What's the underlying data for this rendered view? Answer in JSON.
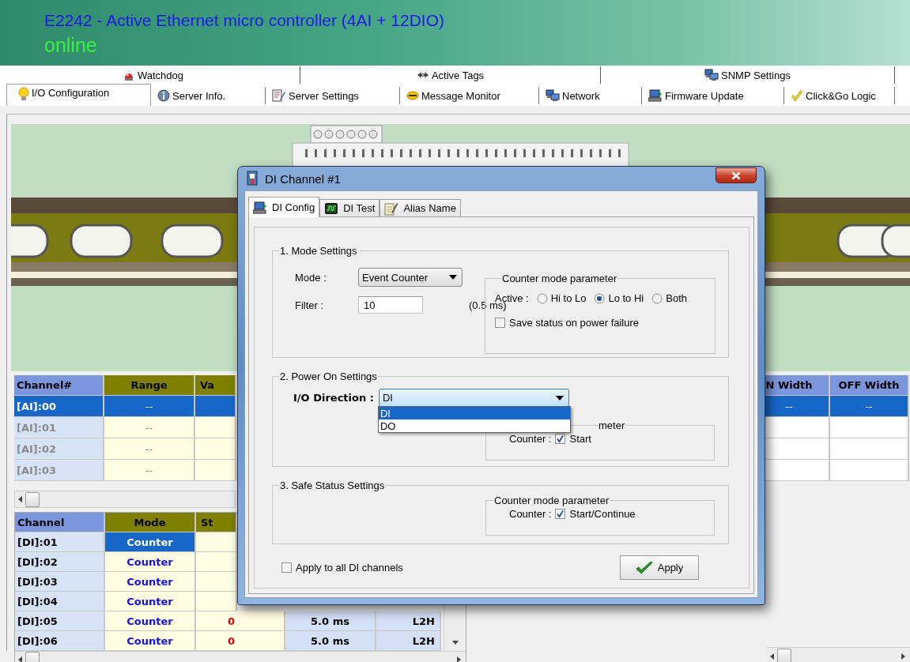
{
  "app": {
    "title": "E2242 - Active Ethernet micro controller (4AI + 12DIO)",
    "status": "online"
  },
  "tabs_top": [
    {
      "label": "Watchdog",
      "selected": false
    },
    {
      "label": "Active Tags",
      "selected": false
    },
    {
      "label": "SNMP Settings",
      "selected": false
    }
  ],
  "tabs_main": [
    {
      "label": "I/O Configuration",
      "selected": true
    },
    {
      "label": "Server Info.",
      "selected": false
    },
    {
      "label": "Server Settings",
      "selected": false
    },
    {
      "label": "Message Monitor",
      "selected": false
    },
    {
      "label": "Network",
      "selected": false
    },
    {
      "label": "Firmware Update",
      "selected": false
    },
    {
      "label": "Click&Go Logic",
      "selected": false
    }
  ],
  "ai_table": {
    "columns": [
      "Channel#",
      "Range",
      "Va",
      "N Width",
      "OFF Width"
    ],
    "rows": [
      {
        "channel": "[AI]:00",
        "range": "--",
        "n_width": "--",
        "off_width": "--",
        "selected": true,
        "disabled": false
      },
      {
        "channel": "[AI]:01",
        "range": "--",
        "selected": false,
        "disabled": true
      },
      {
        "channel": "[AI]:02",
        "range": "--",
        "selected": false,
        "disabled": true
      },
      {
        "channel": "[AI]:03",
        "range": "--",
        "selected": false,
        "disabled": true
      }
    ]
  },
  "di_table": {
    "columns": [
      "Channel",
      "Mode",
      "St"
    ],
    "rows": [
      {
        "channel": "[DI]:01",
        "mode": "Counter",
        "selected": true
      },
      {
        "channel": "[DI]:02",
        "mode": "Counter",
        "selected": false
      },
      {
        "channel": "[DI]:03",
        "mode": "Counter",
        "selected": false
      },
      {
        "channel": "[DI]:04",
        "mode": "Counter",
        "selected": false
      },
      {
        "channel": "[DI]:05",
        "mode": "Counter",
        "selected": false,
        "column_3": "0",
        "column_4": "5.0 ms",
        "column_5": "L2H"
      },
      {
        "channel": "[DI]:06",
        "mode": "Counter",
        "selected": false,
        "column_3": "0",
        "column_4": "5.0 ms",
        "column_5": "L2H"
      }
    ]
  },
  "dialog": {
    "title": "DI Channel #1",
    "tabs": [
      {
        "label": "DI Config",
        "selected": true
      },
      {
        "label": "DI Test",
        "selected": false
      },
      {
        "label": "Alias Name",
        "selected": false
      }
    ],
    "mode_settings": {
      "legend": "1. Mode Settings",
      "mode_label": "Mode :",
      "mode_value": "Event Counter",
      "filter_label": "Filter :",
      "filter_value": "10",
      "filter_unit": "(0.5 ms)",
      "counter": {
        "legend": "Counter mode parameter",
        "active_label": "Active :",
        "options": [
          {
            "label": "Hi to Lo",
            "selected": false
          },
          {
            "label": "Lo to Hi",
            "selected": true
          },
          {
            "label": "Both",
            "selected": false
          }
        ],
        "save": {
          "label": "Save status on power failure",
          "checked": false
        }
      }
    },
    "power_on": {
      "legend": "2. Power On Settings",
      "direction_label": "I/O Direction :",
      "direction_value": "DI",
      "expanded": true,
      "options": [
        {
          "label": "DI",
          "selected": true
        },
        {
          "label": "DO",
          "selected": false
        }
      ],
      "counter": {
        "legend": "meter",
        "label": "Counter :",
        "check": {
          "label": "Start",
          "checked": true
        }
      }
    },
    "safe_status": {
      "legend": "3. Safe Status Settings",
      "counter": {
        "legend": "Counter mode parameter",
        "label": "Counter :",
        "check": {
          "label": "Start/Continue",
          "checked": true
        }
      }
    },
    "apply_all": {
      "label": "Apply to all DI channels",
      "checked": false
    },
    "apply_button": "Apply"
  }
}
